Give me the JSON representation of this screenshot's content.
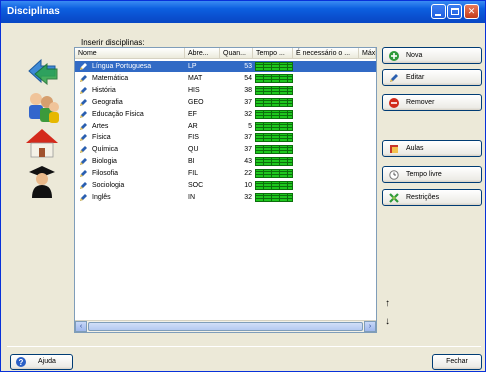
{
  "window": {
    "title": "Disciplinas"
  },
  "list": {
    "label": "Inserir disciplinas:",
    "columns": [
      "Nome",
      "Abre...",
      "Quan...",
      "Tempo ...",
      "É necessário o ...",
      "Máx"
    ],
    "rows": [
      {
        "name": "Língua Portuguesa",
        "abbr": "LP",
        "qty": "53",
        "selected": true
      },
      {
        "name": "Matemática",
        "abbr": "MAT",
        "qty": "54"
      },
      {
        "name": "História",
        "abbr": "HIS",
        "qty": "38"
      },
      {
        "name": "Geografia",
        "abbr": "GEO",
        "qty": "37"
      },
      {
        "name": "Educação Física",
        "abbr": "EF",
        "qty": "32"
      },
      {
        "name": "Artes",
        "abbr": "AR",
        "qty": "5"
      },
      {
        "name": "Física",
        "abbr": "FIS",
        "qty": "37"
      },
      {
        "name": "Química",
        "abbr": "QU",
        "qty": "37"
      },
      {
        "name": "Biologia",
        "abbr": "BI",
        "qty": "43"
      },
      {
        "name": "Filosofia",
        "abbr": "FIL",
        "qty": "22"
      },
      {
        "name": "Sociologia",
        "abbr": "SOC",
        "qty": "10"
      },
      {
        "name": "Inglês",
        "abbr": "IN",
        "qty": "32"
      }
    ]
  },
  "actions": {
    "new": "Nova",
    "edit": "Editar",
    "remove": "Remover",
    "lessons": "Aulas",
    "free_time": "Tempo livre",
    "restrictions": "Restrições"
  },
  "footer": {
    "help": "Ajuda",
    "close": "Fechar"
  },
  "colors": {
    "titlebar": "#0c5fe0",
    "selection": "#316ac5",
    "time_green": "#1ec81e"
  }
}
